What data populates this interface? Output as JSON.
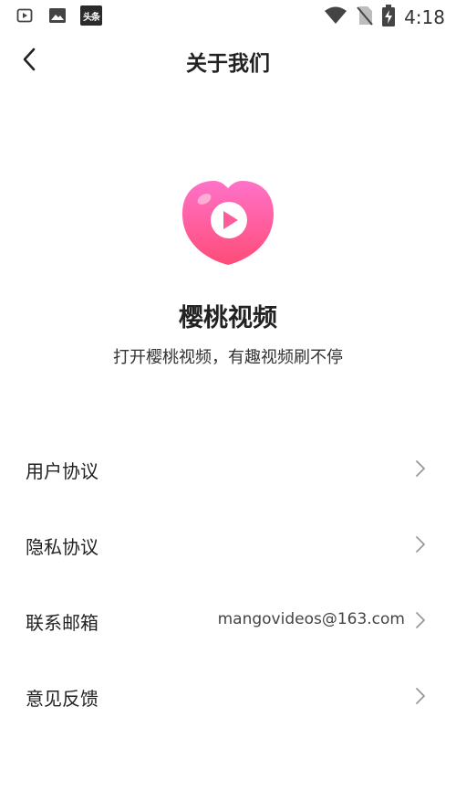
{
  "status_bar": {
    "left_icons": [
      "play-box-icon",
      "image-icon",
      "toutiao-app-icon"
    ],
    "toutiao_label": "头条",
    "right_icons": [
      "wifi-icon",
      "no-sim-icon",
      "battery-charging-icon"
    ],
    "time": "4:18"
  },
  "header": {
    "back_icon": "chevron-left-icon",
    "title": "关于我们"
  },
  "app": {
    "logo_icon": "heart-play-logo",
    "name": "樱桃视频",
    "slogan": "打开樱桃视频，有趣视频刷不停"
  },
  "menu": [
    {
      "label": "用户协议",
      "value": ""
    },
    {
      "label": "隐私协议",
      "value": ""
    },
    {
      "label": "联系邮箱",
      "value": "mangovideos@163.com"
    },
    {
      "label": "意见反馈",
      "value": ""
    }
  ],
  "colors": {
    "logo_gradient_top": "#ff6fc4",
    "logo_gradient_bottom": "#ff4f7b",
    "chevron": "#999999"
  }
}
